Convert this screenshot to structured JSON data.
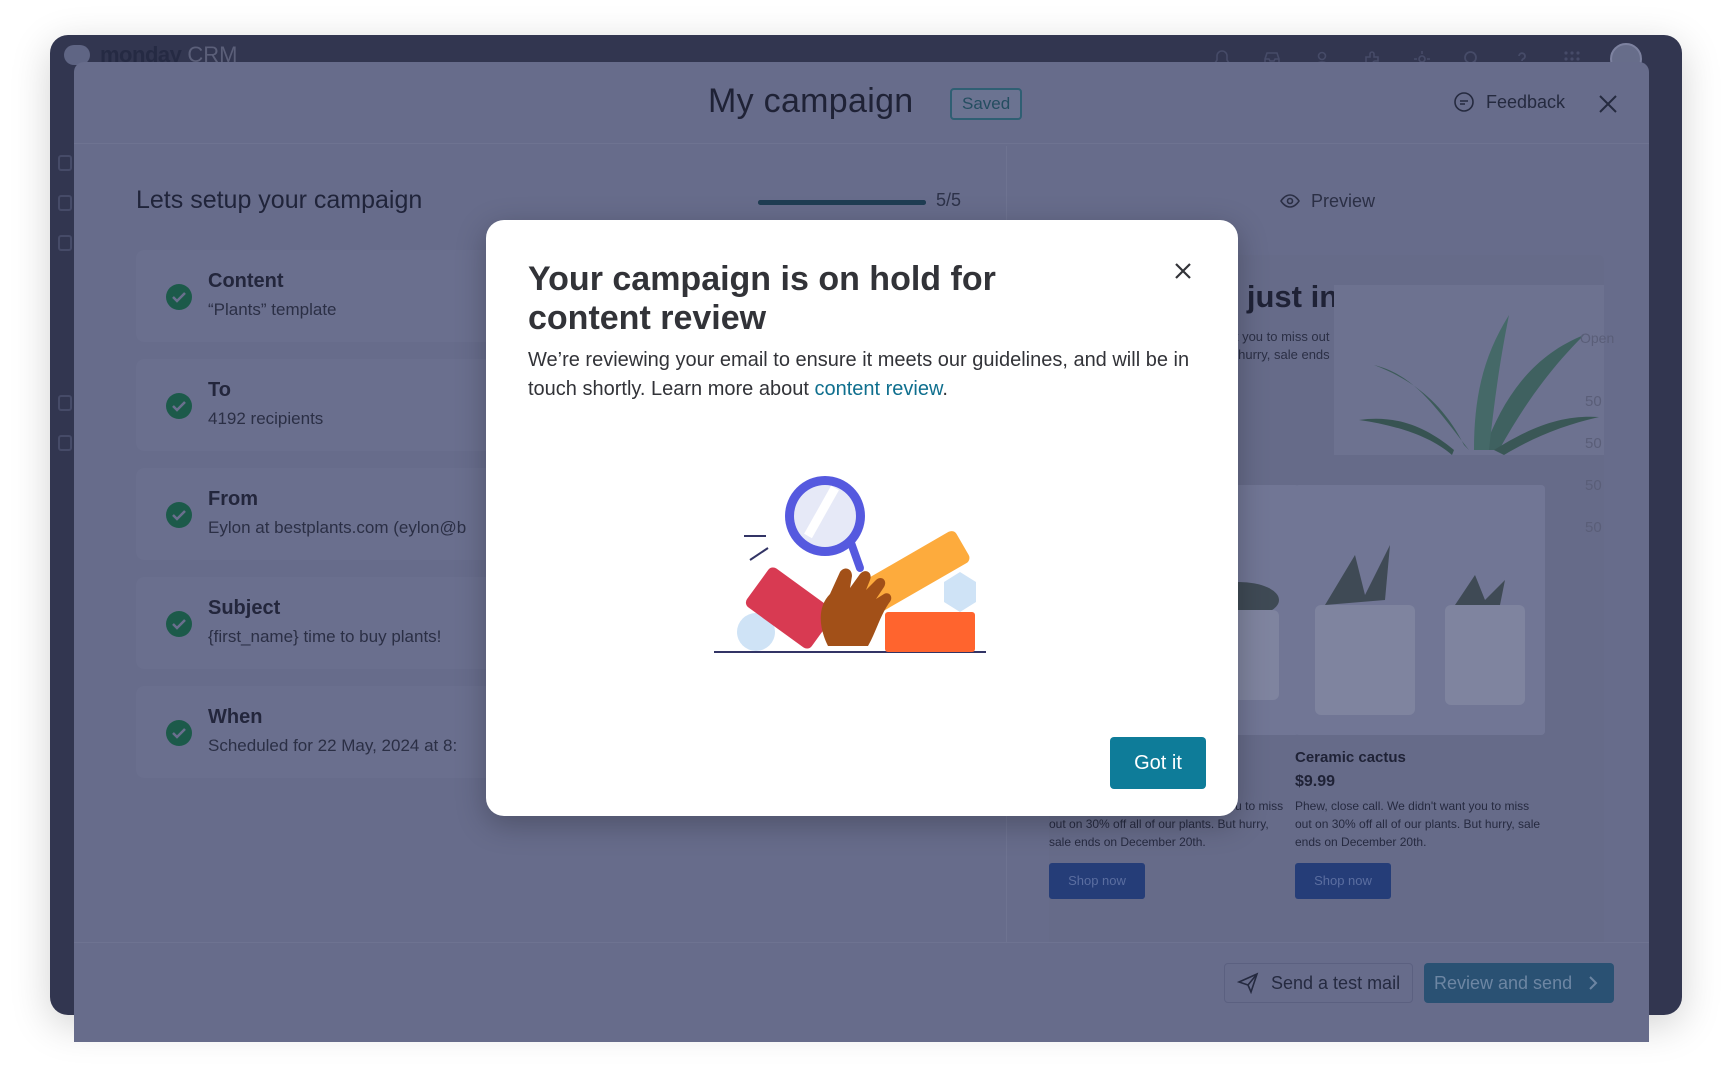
{
  "app": {
    "brand_name": "monday",
    "brand_suffix": "CRM",
    "top_icons": [
      "bell-icon",
      "inbox-icon",
      "invite-member-icon",
      "integrations-icon",
      "settings-icon",
      "search-icon",
      "help-icon",
      "apps-grid-icon"
    ]
  },
  "campaign": {
    "title": "My campaign",
    "status_badge": "Saved",
    "feedback_label": "Feedback"
  },
  "setup": {
    "title": "Lets setup your campaign",
    "progress_text": "5/5",
    "progress_fraction": 1.0,
    "steps": [
      {
        "title": "Content",
        "subtitle": "“Plants” template"
      },
      {
        "title": "To",
        "subtitle": "4192 recipients"
      },
      {
        "title": "From",
        "subtitle": "Eylon at bestplants.com (eylon@b"
      },
      {
        "title": "Subject",
        "subtitle": "{first_name} time to buy plants!"
      },
      {
        "title": "When",
        "subtitle": "Scheduled for 22 May, 2024 at 8:"
      }
    ]
  },
  "preview": {
    "label": "Preview",
    "hero_title": "e just in time!",
    "hero_sub_1": "want you to miss out",
    "hero_sub_2": "But hurry, sale ends",
    "products": [
      {
        "title": "",
        "price": "",
        "description": "Phew, close call. We didn't want you to miss out on 30% off all of our plants. But hurry, sale ends on December 20th.",
        "button": "Shop now"
      },
      {
        "title": "Ceramic cactus",
        "price": "$9.99",
        "description": "Phew, close call. We didn't want you to miss out on 30% off all of our plants. But hurry, sale ends on December 20th.",
        "button": "Shop now"
      }
    ]
  },
  "background_column": {
    "header": "Open",
    "values": [
      "50",
      "50",
      "50",
      "50"
    ]
  },
  "footer": {
    "test_mail_label": "Send a test mail",
    "review_label": "Review and send"
  },
  "modal": {
    "title": "Your campaign is on hold for content review",
    "body_text": "We’re reviewing your email to ensure it meets our guidelines, and will be in touch shortly. Learn more about ",
    "link_text": "content review",
    "body_end": ".",
    "primary_button": "Got it"
  },
  "colors": {
    "accent": "#0e7c99",
    "overlay_panel": "#676c8b",
    "modal_bg": "#ffffff",
    "check_green": "#1c5a4a"
  }
}
